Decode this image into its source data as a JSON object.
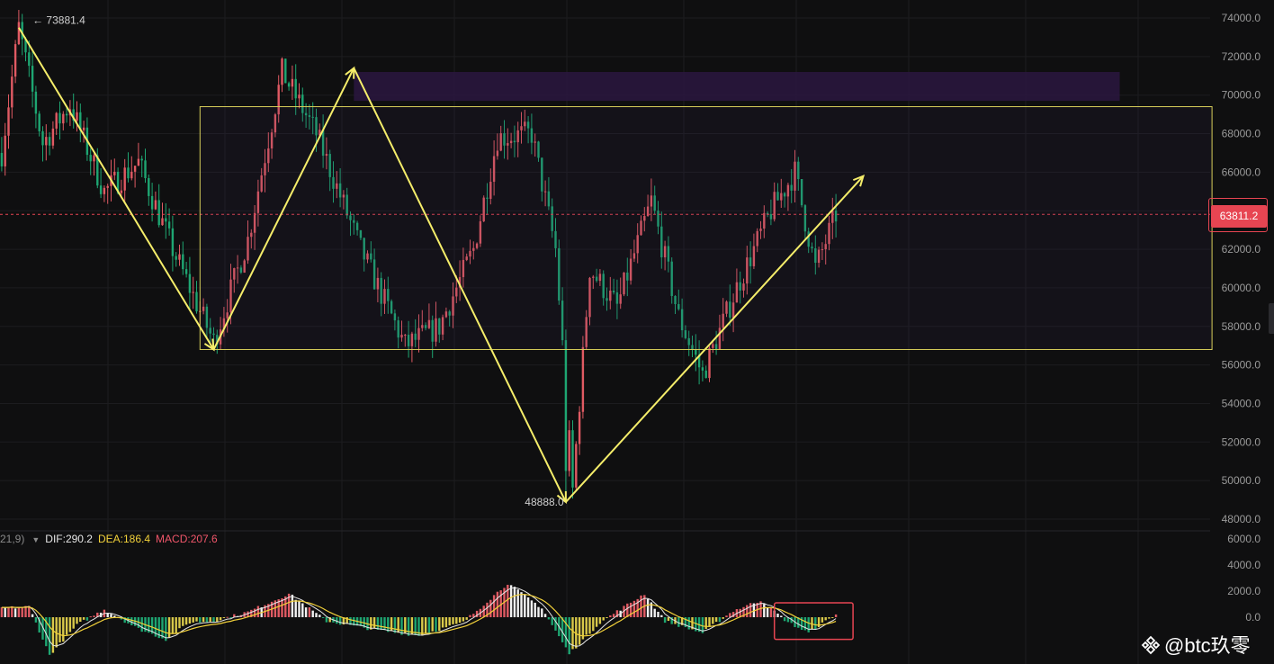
{
  "colors": {
    "background": "#0f0f10",
    "up": "#e05a63",
    "down": "#1ea672",
    "annotation": "#f5ed6a",
    "zone_box": "#d8cf5a",
    "purple_zone": "#2a1640",
    "current_price": "#e74552",
    "dif_line": "#e6e6e6",
    "dea_line": "#f2d13a",
    "axis_text": "#9a9a9a"
  },
  "price_axis": {
    "ticks": [
      "74000.0",
      "72000.0",
      "70000.0",
      "68000.0",
      "66000.0",
      "64000.0",
      "62000.0",
      "60000.0",
      "58000.0",
      "56000.0",
      "54000.0",
      "52000.0",
      "50000.0",
      "48000.0"
    ],
    "range": [
      47500,
      74800
    ]
  },
  "macd_axis": {
    "ticks": [
      "6000.0",
      "4000.0",
      "2000.0",
      "0.0"
    ],
    "range": [
      -3500,
      6300
    ]
  },
  "labels": {
    "high_marker": "← 73881.4",
    "low_marker": "48888.0",
    "current_price": "63811.2"
  },
  "macd_legend": {
    "params": "21,9)",
    "dif": "DIF:290.2",
    "dea": "DEA:186.4",
    "macd": "MACD:207.6"
  },
  "watermark": "@btc玖零",
  "chart_data": {
    "type": "candlestick",
    "title": "",
    "high": 73881.4,
    "low": 48888.0,
    "current_price": 63811.2,
    "price_range": [
      47500,
      74800
    ],
    "anchors": [
      {
        "t": 0,
        "p": 67000
      },
      {
        "t": 5,
        "p": 73500
      },
      {
        "t": 12,
        "p": 67500
      },
      {
        "t": 20,
        "p": 69500
      },
      {
        "t": 30,
        "p": 65000
      },
      {
        "t": 40,
        "p": 66500
      },
      {
        "t": 50,
        "p": 62000
      },
      {
        "t": 62,
        "p": 57200
      },
      {
        "t": 72,
        "p": 62500
      },
      {
        "t": 82,
        "p": 71200
      },
      {
        "t": 92,
        "p": 68000
      },
      {
        "t": 105,
        "p": 62000
      },
      {
        "t": 118,
        "p": 57000
      },
      {
        "t": 128,
        "p": 58000
      },
      {
        "t": 138,
        "p": 62000
      },
      {
        "t": 145,
        "p": 67800
      },
      {
        "t": 155,
        "p": 68000
      },
      {
        "t": 162,
        "p": 62000
      },
      {
        "t": 167,
        "p": 49500
      },
      {
        "t": 172,
        "p": 61000
      },
      {
        "t": 180,
        "p": 59000
      },
      {
        "t": 190,
        "p": 64500
      },
      {
        "t": 198,
        "p": 58500
      },
      {
        "t": 205,
        "p": 55500
      },
      {
        "t": 215,
        "p": 60000
      },
      {
        "t": 225,
        "p": 64000
      },
      {
        "t": 232,
        "p": 66000
      },
      {
        "t": 238,
        "p": 61000
      },
      {
        "t": 244,
        "p": 63811
      }
    ],
    "annotations": {
      "zigzag": [
        [
          5,
          73500
        ],
        [
          62,
          56800
        ],
        [
          103,
          71400
        ],
        [
          165,
          48888
        ],
        [
          252,
          65800
        ]
      ],
      "range_box": {
        "t_start": 58,
        "t_end": 354,
        "price_top": 69400,
        "price_bottom": 56800
      },
      "purple_zone": {
        "t_start": 103,
        "t_end": 327,
        "price_top": 71200,
        "price_bottom": 69700
      },
      "macd_highlight": {
        "t_start": 226,
        "t_end": 249,
        "value_top": 1100,
        "value_bottom": -1700
      }
    },
    "macd": {
      "anchors": [
        {
          "t": 0,
          "v": 700
        },
        {
          "t": 8,
          "v": 800
        },
        {
          "t": 14,
          "v": -2900
        },
        {
          "t": 22,
          "v": -600
        },
        {
          "t": 30,
          "v": 600
        },
        {
          "t": 40,
          "v": -900
        },
        {
          "t": 48,
          "v": -1700
        },
        {
          "t": 55,
          "v": -400
        },
        {
          "t": 62,
          "v": -300
        },
        {
          "t": 72,
          "v": 400
        },
        {
          "t": 84,
          "v": 1800
        },
        {
          "t": 95,
          "v": -300
        },
        {
          "t": 110,
          "v": -1000
        },
        {
          "t": 122,
          "v": -1400
        },
        {
          "t": 135,
          "v": -400
        },
        {
          "t": 148,
          "v": 2600
        },
        {
          "t": 158,
          "v": 700
        },
        {
          "t": 166,
          "v": -2800
        },
        {
          "t": 175,
          "v": -400
        },
        {
          "t": 188,
          "v": 1800
        },
        {
          "t": 194,
          "v": -300
        },
        {
          "t": 205,
          "v": -1200
        },
        {
          "t": 214,
          "v": 500
        },
        {
          "t": 222,
          "v": 1300
        },
        {
          "t": 230,
          "v": -400
        },
        {
          "t": 236,
          "v": -1200
        },
        {
          "t": 244,
          "v": 210
        }
      ],
      "dif": 290.2,
      "dea": 186.4,
      "value": 207.6
    }
  }
}
